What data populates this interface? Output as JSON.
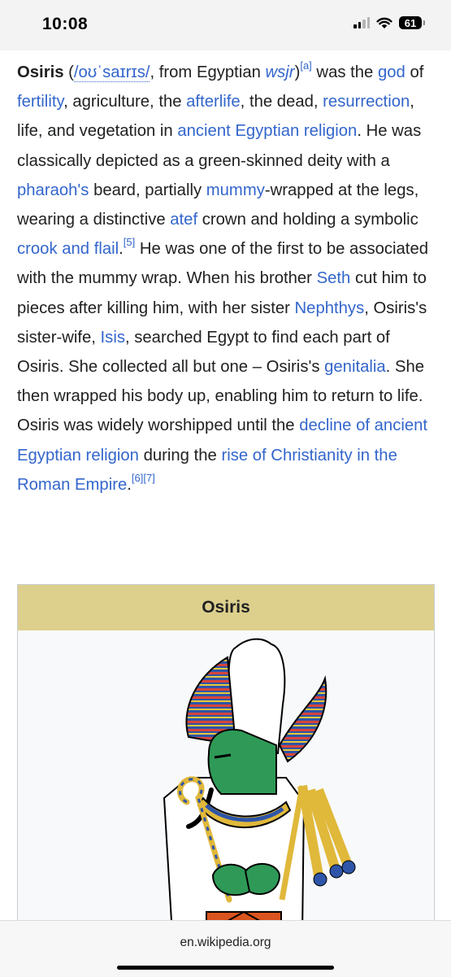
{
  "status_bar": {
    "time": "10:08",
    "battery": "61"
  },
  "article": {
    "t1": "Osiris",
    "t2": " (",
    "t3": "/oʊˈsaɪrɪs/",
    "t4": ", from Egyptian ",
    "t5": "wsjr",
    "t6": ")",
    "t7": "[a]",
    "t8": " was the ",
    "t9": "god",
    "t10": " of ",
    "t11": "fertility",
    "t12": ", agriculture, the ",
    "t13": "afterlife",
    "t14": ", the dead, ",
    "t15": "resurrection",
    "t16": ", life, and vegetation in ",
    "t17": "ancient Egyptian religion",
    "t18": ". He was classically depicted as a green-skinned deity with a ",
    "t19": "pharaoh's",
    "t20": " beard, partially ",
    "t21": "mummy",
    "t22": "-wrapped at the legs, wearing a distinctive ",
    "t23": "atef",
    "t24": " crown and holding a symbolic ",
    "t25": "crook and flail",
    "t26": ".",
    "t27": "[5]",
    "t28": " He was one of the first to be associated with the mummy wrap. When his brother ",
    "t29": "Seth",
    "t30": " cut him to pieces after killing him, with her sister ",
    "t31": "Nephthys",
    "t32": ", Osiris's sister-wife, ",
    "t33": "Isis",
    "t34": ", searched Egypt to find each part of Osiris. She collected all but one – Osiris's ",
    "t35": "genitalia",
    "t36": ". She then wrapped his body up, enabling him to return to life. Osiris was widely worshipped until the ",
    "t37": "decline of ancient Egyptian religion",
    "t38": " during the ",
    "t39": "rise of Christianity in the Roman Empire",
    "t40": ".",
    "t41": "[6]",
    "t42": "[7]"
  },
  "infobox": {
    "title": "Osiris"
  },
  "browser": {
    "url": "en.wikipedia.org"
  },
  "colors": {
    "link": "#3366cc",
    "infobox_header": "#ddd08d",
    "text": "#202122"
  }
}
